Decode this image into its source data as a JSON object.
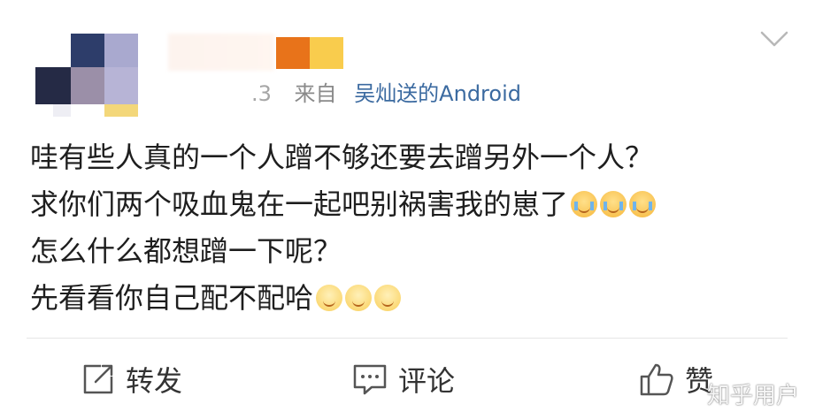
{
  "post": {
    "time": ".3",
    "from_label": "来自",
    "source": "吴灿送的Android",
    "lines": [
      "哇有些人真的一个人蹭不够还要去蹭另外一个人？",
      "求你们两个吸血鬼在一起吧别祸害我的崽了",
      "怎么什么都想蹭一下呢？",
      "先看看你自己配不配哈"
    ],
    "emoji": {
      "cry_count": 3,
      "smile_count": 3
    }
  },
  "actions": {
    "repost": "转发",
    "comment": "评论",
    "like": "赞"
  },
  "watermark": "知乎用户",
  "icons": {
    "avatar": "avatar-pixelated",
    "chevron": "chevron-down-icon",
    "repost": "share-icon",
    "comment": "comment-icon",
    "like": "thumbs-up-icon"
  },
  "colors": {
    "source_link": "#3b6aa0",
    "meta_gray": "#8a8a8a",
    "badge_orange": "#e8731a",
    "badge_yellow": "#f9cc4d"
  }
}
